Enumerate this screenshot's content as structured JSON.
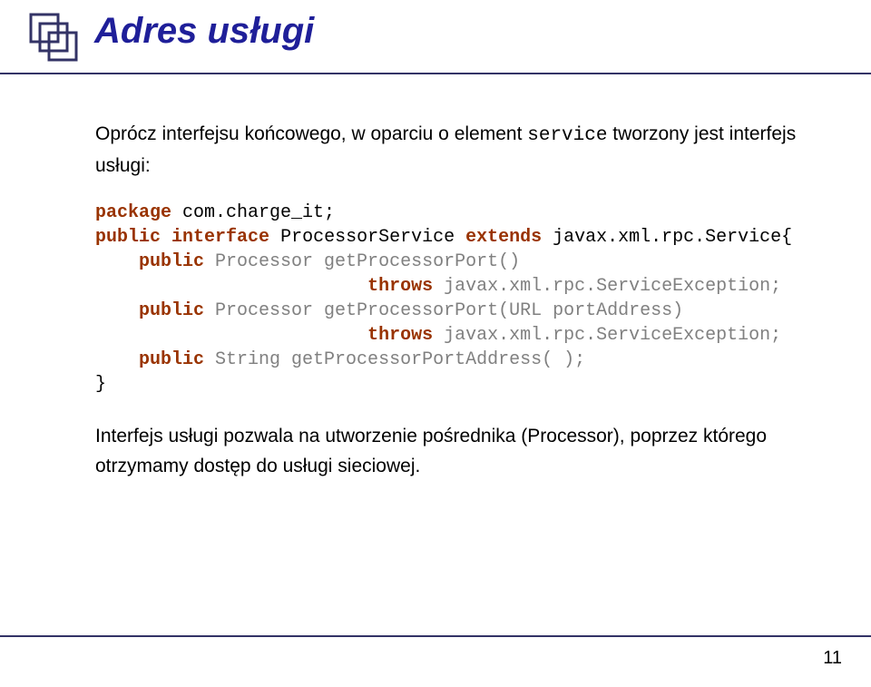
{
  "title": "Adres usługi",
  "para1_a": "Oprócz interfejsu końcowego, w oparciu o element ",
  "para1_mono": "service",
  "para1_b": " tworzony jest interfejs usługi:",
  "code": {
    "l1a": "package",
    "l1b": " com.charge_it;",
    "l2a": "public",
    "l2b": " ",
    "l2c": "interface",
    "l2d": " ProcessorService ",
    "l2e": "extends",
    "l2f": " javax.xml.rpc.Service{",
    "l3a": "    ",
    "l3b": "public",
    "l3c": " Processor getProcessorPort()",
    "l4a": "                         ",
    "l4b": "throws",
    "l4c": " javax.xml.rpc.ServiceException;",
    "l5a": "    ",
    "l5b": "public",
    "l5c": " Processor getProcessorPort(URL portAddress)",
    "l6a": "                         ",
    "l6b": "throws",
    "l6c": " javax.xml.rpc.ServiceException;",
    "l7a": "    ",
    "l7b": "public",
    "l7c": " String getProcessorPortAddress( );",
    "l8": "}"
  },
  "para2": "Interfejs usługi pozwala na utworzenie pośrednika (Processor), poprzez którego otrzymamy dostęp do usługi sieciowej.",
  "pagenum": "11",
  "icon_name": "stacked-squares-icon"
}
